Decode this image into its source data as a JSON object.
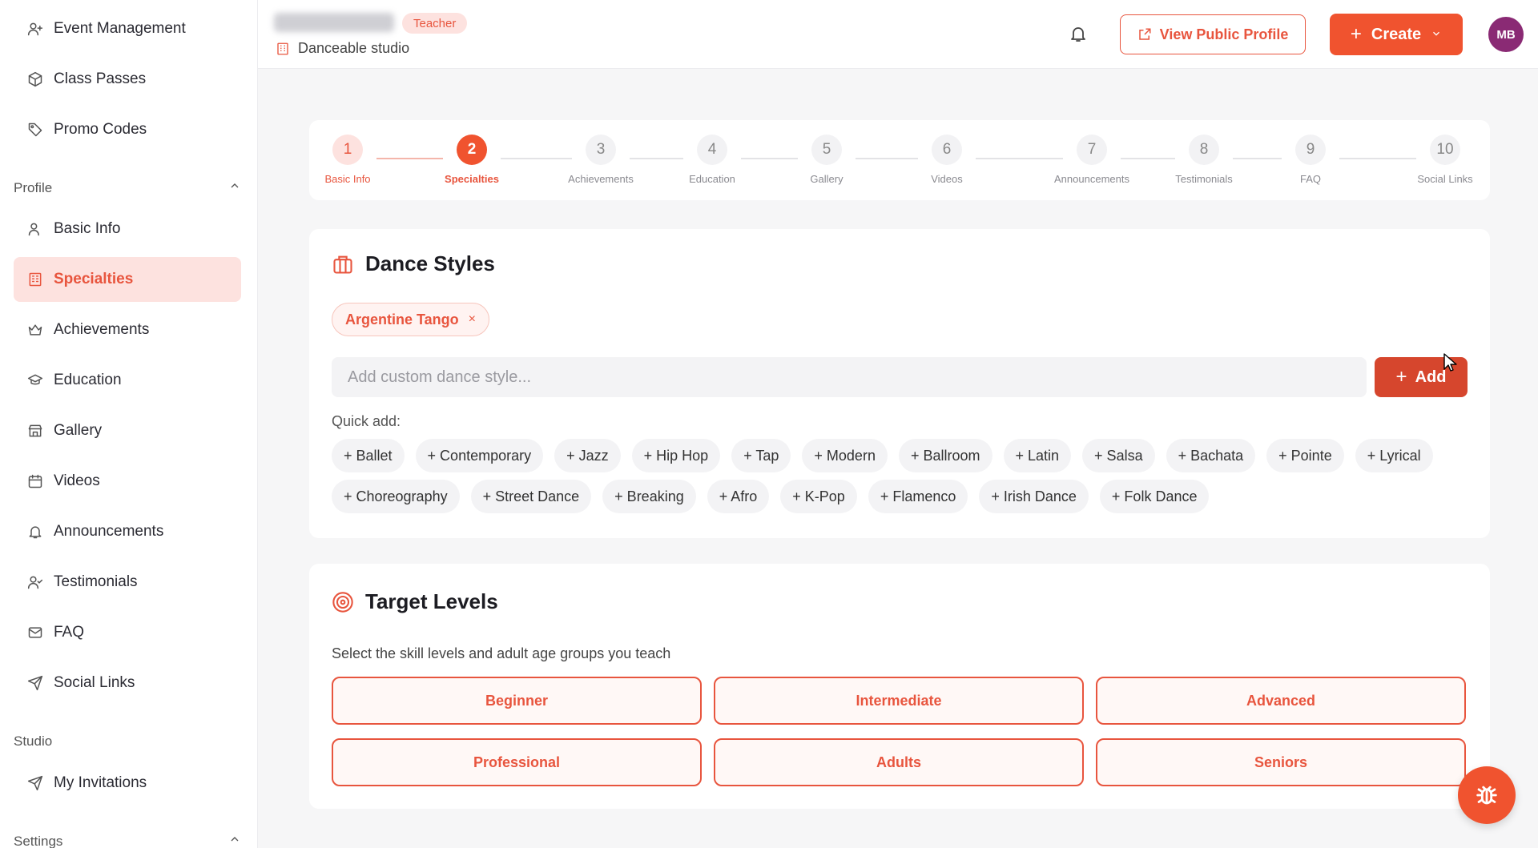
{
  "sidebar": {
    "items_top": [
      {
        "label": "Event Management",
        "icon": "user-plus-icon"
      },
      {
        "label": "Class Passes",
        "icon": "package-icon"
      },
      {
        "label": "Promo Codes",
        "icon": "tag-icon"
      }
    ],
    "profile_section": "Profile",
    "profile_items": [
      {
        "label": "Basic Info",
        "icon": "user-icon"
      },
      {
        "label": "Specialties",
        "icon": "building-icon"
      },
      {
        "label": "Achievements",
        "icon": "crown-icon"
      },
      {
        "label": "Education",
        "icon": "graduation-cap-icon"
      },
      {
        "label": "Gallery",
        "icon": "store-icon"
      },
      {
        "label": "Videos",
        "icon": "calendar-icon"
      },
      {
        "label": "Announcements",
        "icon": "bell-icon"
      },
      {
        "label": "Testimonials",
        "icon": "user-check-icon"
      },
      {
        "label": "FAQ",
        "icon": "mail-icon"
      },
      {
        "label": "Social Links",
        "icon": "send-icon"
      }
    ],
    "studio_section": "Studio",
    "studio_items": [
      {
        "label": "My Invitations",
        "icon": "send-icon"
      }
    ],
    "settings_section": "Settings",
    "active_item": "Specialties"
  },
  "header": {
    "role_badge": "Teacher",
    "studio_name": "Danceable studio",
    "view_profile_label": "View Public Profile",
    "create_label": "Create",
    "avatar_initials": "MB"
  },
  "stepper": {
    "current": 2,
    "steps": [
      {
        "num": "1",
        "label": "Basic Info"
      },
      {
        "num": "2",
        "label": "Specialties"
      },
      {
        "num": "3",
        "label": "Achievements"
      },
      {
        "num": "4",
        "label": "Education"
      },
      {
        "num": "5",
        "label": "Gallery"
      },
      {
        "num": "6",
        "label": "Videos"
      },
      {
        "num": "7",
        "label": "Announcements"
      },
      {
        "num": "8",
        "label": "Testimonials"
      },
      {
        "num": "9",
        "label": "FAQ"
      },
      {
        "num": "10",
        "label": "Social Links"
      }
    ]
  },
  "dance_styles": {
    "title": "Dance Styles",
    "selected": [
      "Argentine Tango"
    ],
    "remove_glyph": "×",
    "input_placeholder": "Add custom dance style...",
    "add_label": "Add",
    "quick_add_label": "Quick add:",
    "quick_row1": [
      "+ Ballet",
      "+ Contemporary",
      "+ Jazz",
      "+ Hip Hop",
      "+ Tap",
      "+ Modern",
      "+ Ballroom",
      "+ Latin",
      "+ Salsa",
      "+ Bachata",
      "+ Pointe",
      "+ Lyrical"
    ],
    "quick_row2": [
      "+ Choreography",
      "+ Street Dance",
      "+ Breaking",
      "+ Afro",
      "+ K-Pop",
      "+ Flamenco",
      "+ Irish Dance",
      "+ Folk Dance"
    ]
  },
  "target_levels": {
    "title": "Target Levels",
    "subtitle": "Select the skill levels and adult age groups you teach",
    "levels": [
      "Beginner",
      "Intermediate",
      "Advanced",
      "Professional",
      "Adults",
      "Seniors"
    ]
  },
  "colors": {
    "accent": "#f0532f",
    "accent_text": "#e8553e",
    "accent_soft": "#fde2df"
  }
}
